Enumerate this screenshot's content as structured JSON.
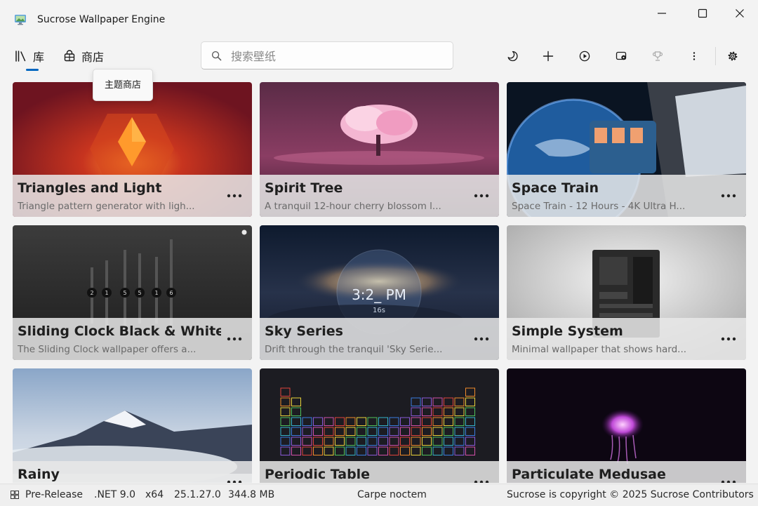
{
  "window": {
    "title": "Sucrose Wallpaper Engine",
    "icon": "monitor-icon"
  },
  "nav": {
    "library": {
      "label": "库",
      "icon": "library-icon"
    },
    "store": {
      "label": "商店",
      "icon": "store-icon"
    }
  },
  "search": {
    "placeholder": "搜索壁纸",
    "value": ""
  },
  "tooltip": {
    "text": "主题商店"
  },
  "toolbar": [
    "moon-icon",
    "plus-icon",
    "play-icon",
    "display-settings-icon",
    "trophy-icon",
    "more-vertical-icon",
    "gear-icon"
  ],
  "wallpapers": [
    {
      "title": "Triangles and Light",
      "description": "Triangle pattern generator with ligh..."
    },
    {
      "title": "Spirit Tree",
      "description": "A tranquil 12-hour cherry blossom l..."
    },
    {
      "title": "Space Train",
      "description": "Space Train - 12 Hours - 4K Ultra H..."
    },
    {
      "title": "Sliding Clock Black & White",
      "description": "The Sliding Clock wallpaper offers a..."
    },
    {
      "title": "Sky Series",
      "description": "Drift through the tranquil 'Sky Serie..."
    },
    {
      "title": "Simple System",
      "description": "Minimal wallpaper that shows hard..."
    },
    {
      "title": "Rainy",
      "description": ""
    },
    {
      "title": "Periodic Table",
      "description": ""
    },
    {
      "title": "Particulate Medusae",
      "description": ""
    }
  ],
  "thumb_text": {
    "clock_digits": [
      "2",
      "1",
      "5",
      "5",
      "1",
      "6"
    ],
    "sky_time": "3:2_ PM",
    "sky_seconds": "16s"
  },
  "status": {
    "channel": "Pre-Release",
    "framework": ".NET 9.0",
    "arch": "x64",
    "version": "25.1.27.0",
    "memory": "344.8 MB",
    "motto": "Carpe noctem",
    "copyright": "Sucrose is copyright © 2025 Sucrose Contributors"
  },
  "colors": {
    "accent": "#0067c0"
  }
}
